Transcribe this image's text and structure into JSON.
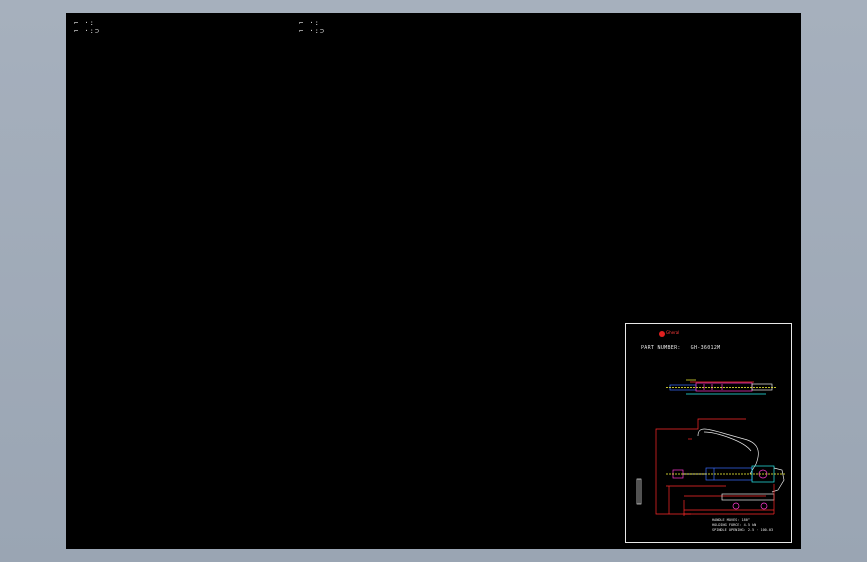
{
  "drawing": {
    "ucs_left": "⌐ ·:",
    "ucs_left_b": "⌐ ·:⊃",
    "ucs_right": "⌐ ·:",
    "ucs_right_b": "⌐ ·:⊃"
  },
  "titleblock": {
    "brand": "Gheral",
    "part_number_label": "PART NUMBER:",
    "part_number_value": "GH-36012M",
    "notes": [
      "HANDLE MOVES: 180°",
      "HOLDING FORCE: 4.5 kN",
      "SPINDLE OPENING: 2.5 · 100-03"
    ]
  },
  "colors": {
    "background": "#9aa5b3",
    "canvas": "#000000",
    "lines": "#e8e8e8",
    "dimension": "#ff2a2a",
    "part_magenta": "#ff3bd1",
    "part_cyan": "#28f0f0",
    "part_blue": "#3a6cff",
    "part_yellow": "#ffff3a"
  }
}
